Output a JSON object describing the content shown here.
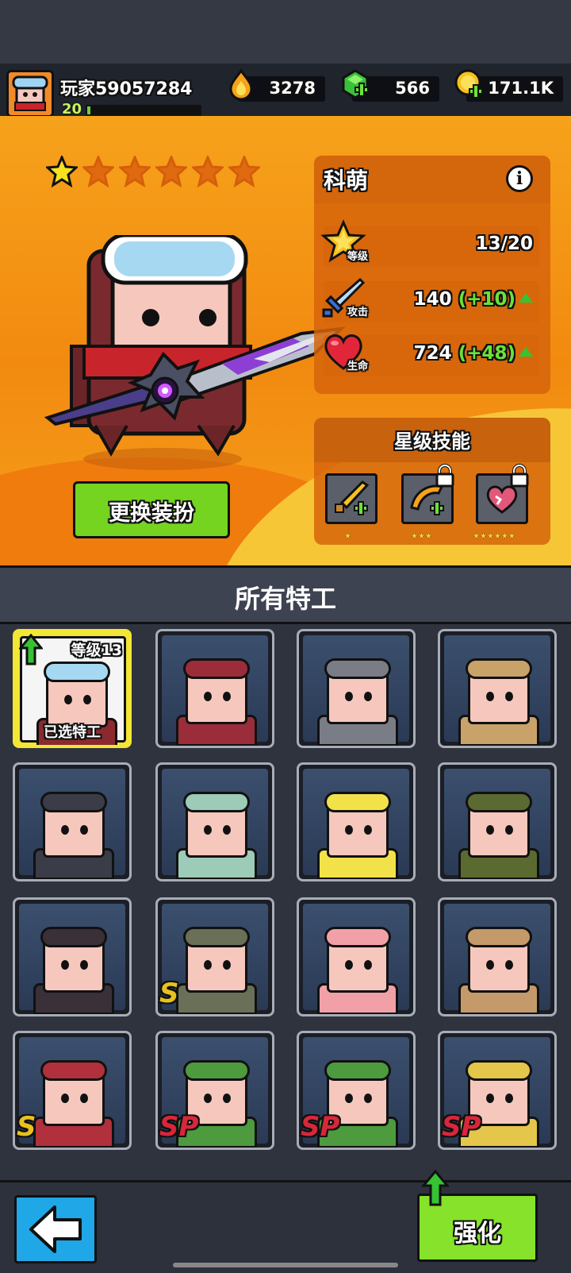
{
  "header": {
    "player_name": "玩家59057284",
    "player_level": "20",
    "xp_fraction": 0.03,
    "currencies": [
      {
        "icon": "fire-drop-icon",
        "value": "3278"
      },
      {
        "icon": "green-gem-icon",
        "value": "566"
      },
      {
        "icon": "gold-coin-icon",
        "value": "171.1K"
      }
    ]
  },
  "hero": {
    "name": "科萌",
    "stars_total": 6,
    "stars_filled": 1,
    "stats": [
      {
        "label": "等级",
        "value": "13/20",
        "bonus": ""
      },
      {
        "label": "攻击",
        "value": "140",
        "bonus": "(+10)"
      },
      {
        "label": "生命",
        "value": "724",
        "bonus": "(+48)"
      }
    ],
    "skills_title": "星级技能",
    "skills": [
      {
        "icon": "sword-plus-icon",
        "stars": "★",
        "locked": false
      },
      {
        "icon": "boomerang-plus-icon",
        "stars": "★★★",
        "locked": true
      },
      {
        "icon": "heart-burst-icon",
        "stars": "★★★★★★",
        "locked": true
      }
    ],
    "change_outfit_label": "更换装扮"
  },
  "agents": {
    "title": "所有特工",
    "selected_level_label": "等级13",
    "selected_label": "已选特工",
    "cards": [
      {
        "name": "agent-goggles",
        "badge": "",
        "color": "#8b2a2e"
      },
      {
        "name": "agent-red-hair-scarf",
        "badge": "",
        "color": "#9b2d3a"
      },
      {
        "name": "agent-cat",
        "badge": "",
        "color": "#7a7d86"
      },
      {
        "name": "agent-robot-hood",
        "badge": "",
        "color": "#c9a26a"
      },
      {
        "name": "agent-ginger-hair",
        "badge": "",
        "color": "#3a3d48"
      },
      {
        "name": "agent-squidward",
        "badge": "",
        "color": "#9ccbb7"
      },
      {
        "name": "agent-spongebob",
        "badge": "",
        "color": "#f2e24a"
      },
      {
        "name": "agent-bearded-soldier",
        "badge": "",
        "color": "#5b6a30"
      },
      {
        "name": "agent-pink-hair",
        "badge": "",
        "color": "#3a3038"
      },
      {
        "name": "agent-panda",
        "badge": "S",
        "color": "#6a6f58"
      },
      {
        "name": "agent-patrick",
        "badge": "",
        "color": "#f2a0a8"
      },
      {
        "name": "agent-sandy",
        "badge": "",
        "color": "#c49a6b"
      },
      {
        "name": "agent-red-hair-fighter",
        "badge": "S",
        "color": "#b0303c"
      },
      {
        "name": "agent-leonardo",
        "badge": "SP",
        "color": "#4e9a3e"
      },
      {
        "name": "agent-raphael",
        "badge": "SP",
        "color": "#4e9a3e"
      },
      {
        "name": "agent-april",
        "badge": "SP",
        "color": "#e3c64a"
      }
    ]
  },
  "bottom": {
    "back_icon": "back-arrow-icon",
    "boost_label": "强化"
  }
}
